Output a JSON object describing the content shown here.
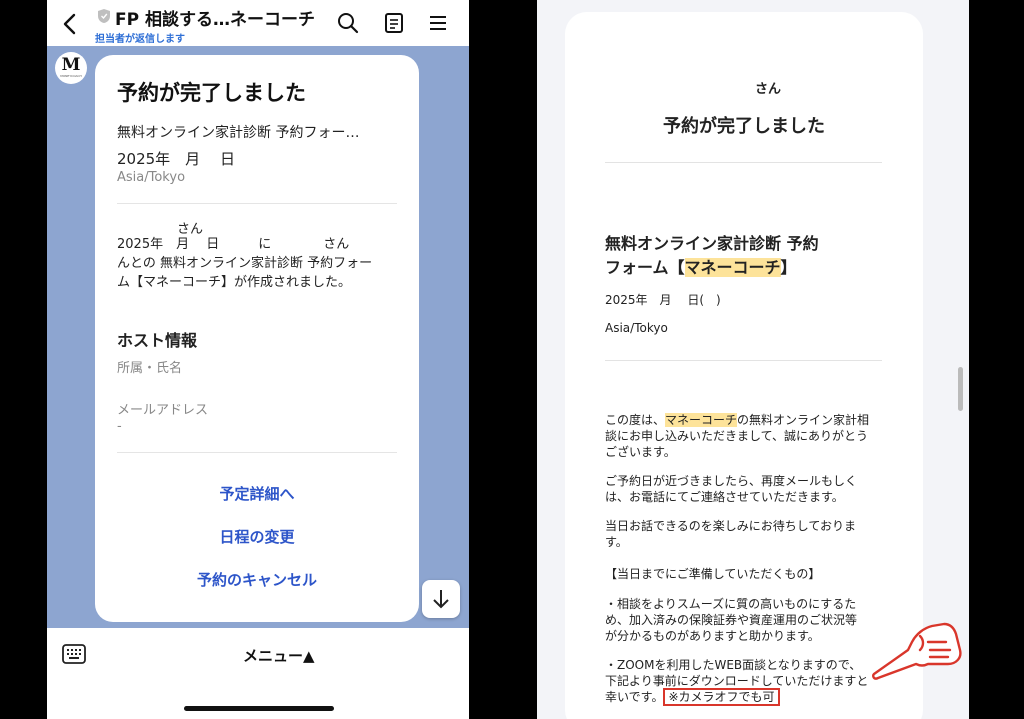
{
  "left": {
    "header": {
      "title": "FP 相談する…ネーコーチ",
      "subtitle": "担当者が返信します"
    },
    "avatar": {
      "letter": "M",
      "caption": "MONEYCOACH"
    },
    "card": {
      "title": "予約が完了しました",
      "form_name": "無料オンライン家計診断 予約フォー…",
      "date": "2025年　月　 日",
      "timezone": "Asia/Tokyo",
      "san": "さん",
      "message": "2025年　月　 日　　　に　　　　さん\nんとの 無料オンライン家計診断 予約フォー\nム【マネーコーチ】が作成されました。",
      "host_heading": "ホスト情報",
      "affiliation": "所属・氏名",
      "mail_label": "メールアドレス",
      "mail_value": "-",
      "links": [
        "予定詳細へ",
        "日程の変更",
        "予約のキャンセル"
      ]
    },
    "bottom": {
      "menu_label": "メニュー▲"
    }
  },
  "right": {
    "email": {
      "san": "さん",
      "title": "予約が完了しました",
      "form_line1": "無料オンライン家計診断 予約",
      "form_line2_pre": "フォーム【",
      "form_line2_hl": "マネーコーチ",
      "form_line2_post": "】",
      "date": "2025年　月　 日(　)",
      "timezone": "Asia/Tokyo",
      "p1_pre": "この度は、",
      "p1_hl": "マネーコーチ",
      "p1_post": "の無料オンライン家計相\n談にお申し込みいただきまして、誠にありがとう\nございます。",
      "p2": "ご予約日が近づきましたら、再度メールもしく\nは、お電話にてご連絡させていただきます。",
      "p3": "当日お話できるのを楽しみにお待ちしておりま\nす。",
      "p4": "【当日までにご準備していただくもの】",
      "p5": "・相談をよりスムーズに質の高いものにするた\nめ、加入済みの保険証券や資産運用のご状況等\nが分かるものがありますと助かります。",
      "p6": "・ZOOMを利用したWEB面談となりますので、\n下記より事前にダウンロードしていただけますと\n幸いです。",
      "p6_boxed": "※カメラオフでも可"
    }
  },
  "colors": {
    "link": "#2d55c9",
    "chat_bg": "#8da5d0",
    "highlight": "#fde39a",
    "annotation": "#d9362b"
  }
}
